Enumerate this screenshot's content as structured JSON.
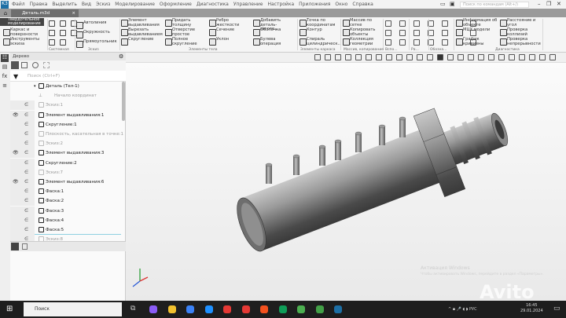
{
  "app": {
    "logo": "K3",
    "menu": [
      "Файл",
      "Правка",
      "Выделить",
      "Вид",
      "Эскиз",
      "Моделирование",
      "Оформление",
      "Диагностика",
      "Управление",
      "Настройка",
      "Приложения",
      "Окно",
      "Справка"
    ],
    "search_placeholder": "Поиск по командам (Alt+/)",
    "tab_title": "Деталь.m3d"
  },
  "ribbon": {
    "modes": [
      "Твердотельное моделирование",
      "Каркас и поверхности",
      "Инструменты эскиза"
    ],
    "sketch": [
      "Автолиния",
      "Окружность",
      "Прямоугольник"
    ],
    "body": [
      "Элемент выдавливания",
      "Вырезать выдавливанием",
      "Скругление",
      "Придать толщину",
      "Отверстие простое",
      "Полное скругление",
      "Ребро жесткости",
      "Сечение",
      "Уклон",
      "Добавить деталь-загото...",
      "Оболочка",
      "Булева операция"
    ],
    "frame": [
      "Точка по координатам",
      "Контур",
      "Спираль цилиндрическ..."
    ],
    "arrays": [
      "Массив по сетке",
      "Копировать объекты",
      "Коллекция геометрии"
    ],
    "diag": [
      "Информация об объекте",
      "МЦХ модели",
      "График кривизны",
      "Расстояние и угол",
      "Проверка коллизий",
      "Проверка непрерывности"
    ],
    "groups": [
      "Системная",
      "Эскиз",
      "Элементы тела",
      "Элементы каркаса",
      "Массив, копирование",
      "Вспо...",
      "Ра...",
      "Обозна...",
      "Диагностика"
    ]
  },
  "tree": {
    "title": "Дерево",
    "search_placeholder": "Поиск (Ctrl+F)",
    "rows": [
      {
        "label": "Деталь (Тел-1)",
        "dim": false,
        "eye": false
      },
      {
        "label": "Начало координат",
        "dim": true,
        "eye": false
      },
      {
        "label": "Эскиз:1",
        "dim": true,
        "eye": false
      },
      {
        "label": "Элемент выдавливания:1",
        "dim": false,
        "eye": true
      },
      {
        "label": "Скругление:1",
        "dim": false,
        "eye": false
      },
      {
        "label": "Плоскость, касательная в точке:1",
        "dim": true,
        "eye": false
      },
      {
        "label": "Эскиз:2",
        "dim": true,
        "eye": false
      },
      {
        "label": "Элемент выдавливания:3",
        "dim": false,
        "eye": true
      },
      {
        "label": "Скругление:2",
        "dim": false,
        "eye": false
      },
      {
        "label": "Эскиз:7",
        "dim": true,
        "eye": false
      },
      {
        "label": "Элемент выдавливания:6",
        "dim": false,
        "eye": true
      },
      {
        "label": "Фаска:1",
        "dim": false,
        "eye": false
      },
      {
        "label": "Фаска:2",
        "dim": false,
        "eye": false
      },
      {
        "label": "Фаска:3",
        "dim": false,
        "eye": false
      },
      {
        "label": "Фаска:4",
        "dim": false,
        "eye": false
      },
      {
        "label": "Фаска:5",
        "dim": false,
        "eye": false
      },
      {
        "label": "Эскиз:8",
        "dim": true,
        "eye": false
      }
    ]
  },
  "viewport": {
    "activate_line1": "Активация Windows",
    "activate_line2": "Чтобы активировать Windows, перейдите в раздел «Параметры»."
  },
  "taskbar": {
    "search": "Поиск",
    "lang": "РУС",
    "time": "16:45",
    "date": "29.01.2024",
    "watermark": "Avito",
    "app_colors": [
      "#8a5cf6",
      "#f2c12e",
      "#3b82f6",
      "#1e90ff",
      "#e53935",
      "#e53935",
      "#f4511e",
      "#0f9d58",
      "#4caf50",
      "#43a047",
      "#1d6fa5"
    ]
  }
}
